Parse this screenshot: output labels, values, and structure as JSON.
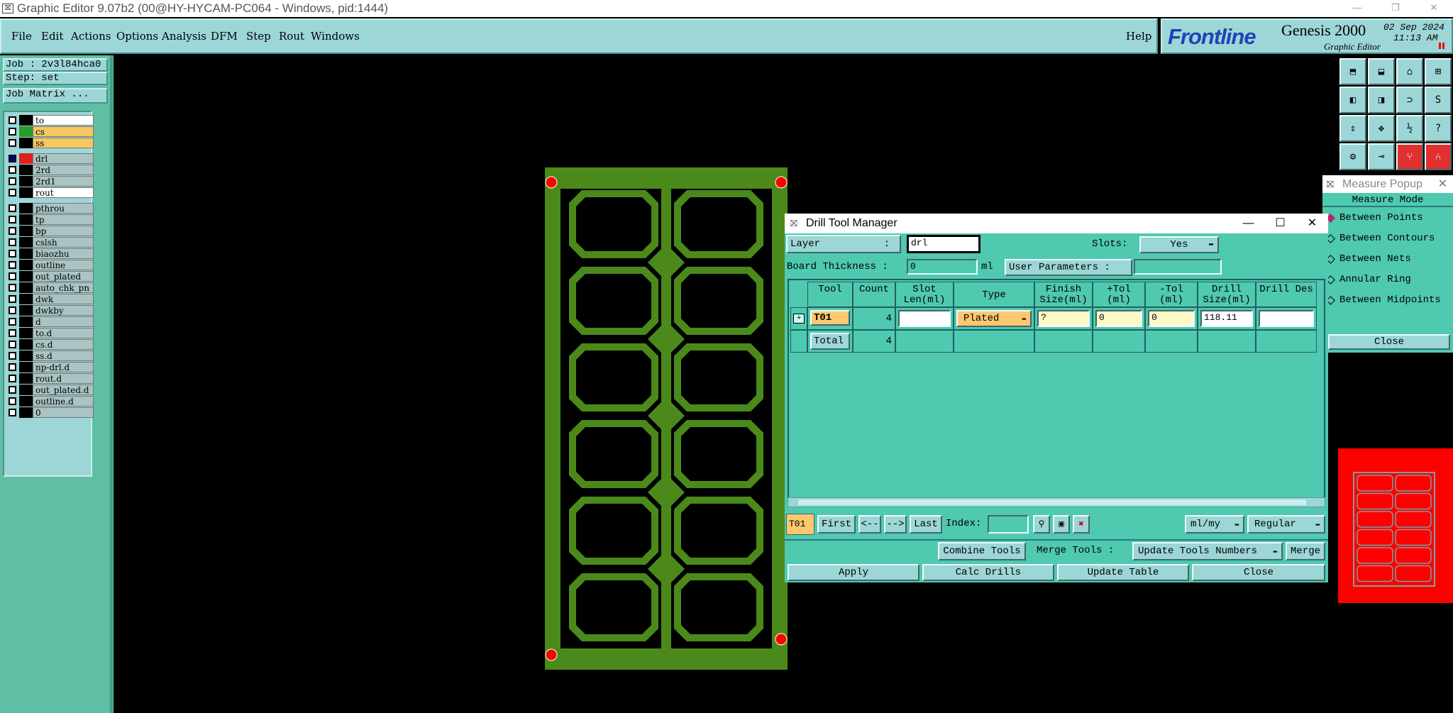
{
  "window": {
    "title": "Graphic Editor 9.07b2 (00@HY-HYCAM-PC064 - Windows, pid:1444)"
  },
  "menu": {
    "items": [
      "File",
      "Edit",
      "Actions",
      "Options",
      "Analysis",
      "DFM",
      "Step",
      "Rout",
      "Windows"
    ],
    "help": "Help"
  },
  "brand": {
    "logo": "Frontline",
    "product": "Genesis 2000",
    "subtitle": "Graphic Editor",
    "date": "02 Sep 2024",
    "time": "11:13 AM"
  },
  "left_panel": {
    "job": "Job : 2v3l84hca0",
    "step": "Step: set",
    "job_matrix": "Job Matrix ...",
    "layers": [
      {
        "name": "to",
        "swatch": "#000000",
        "bg": "#ffffff"
      },
      {
        "name": "cs",
        "swatch": "#2a9a2a",
        "bg": "#f5c860"
      },
      {
        "name": "ss",
        "swatch": "#000000",
        "bg": "#f5c860"
      },
      {
        "name": "drl",
        "swatch": "#e02020",
        "bg": "#aac4c4",
        "checked": true
      },
      {
        "name": "2rd",
        "swatch": "#000000",
        "bg": "#aac4c4"
      },
      {
        "name": "2rd1",
        "swatch": "#000000",
        "bg": "#aac4c4"
      },
      {
        "name": "rout",
        "swatch": "#000000",
        "bg": "#ffffff"
      },
      {
        "name": "pthrou",
        "swatch": "#000000",
        "bg": "#aac4c4"
      },
      {
        "name": "tp",
        "swatch": "#000000",
        "bg": "#aac4c4"
      },
      {
        "name": "bp",
        "swatch": "#000000",
        "bg": "#aac4c4"
      },
      {
        "name": "cslsh",
        "swatch": "#000000",
        "bg": "#aac4c4"
      },
      {
        "name": "biaozhu",
        "swatch": "#000000",
        "bg": "#aac4c4"
      },
      {
        "name": "outline",
        "swatch": "#000000",
        "bg": "#aac4c4"
      },
      {
        "name": "out_plated",
        "swatch": "#000000",
        "bg": "#aac4c4"
      },
      {
        "name": "auto_chk_pn",
        "swatch": "#000000",
        "bg": "#aac4c4"
      },
      {
        "name": "dwk",
        "swatch": "#000000",
        "bg": "#aac4c4"
      },
      {
        "name": "dwkby",
        "swatch": "#000000",
        "bg": "#aac4c4"
      },
      {
        "name": "d",
        "swatch": "#000000",
        "bg": "#aac4c4"
      },
      {
        "name": "to.d",
        "swatch": "#000000",
        "bg": "#aac4c4"
      },
      {
        "name": "cs.d",
        "swatch": "#000000",
        "bg": "#aac4c4"
      },
      {
        "name": "ss.d",
        "swatch": "#000000",
        "bg": "#aac4c4"
      },
      {
        "name": "np-drl.d",
        "swatch": "#000000",
        "bg": "#aac4c4"
      },
      {
        "name": "rout.d",
        "swatch": "#000000",
        "bg": "#aac4c4"
      },
      {
        "name": "out_plated.d",
        "swatch": "#000000",
        "bg": "#aac4c4"
      },
      {
        "name": "outline.d",
        "swatch": "#000000",
        "bg": "#aac4c4"
      },
      {
        "name": "0",
        "swatch": "#000000",
        "bg": "#aac4c4"
      }
    ]
  },
  "measure_popup": {
    "title": "Measure Popup",
    "mode_label": "Measure Mode",
    "options": [
      "Between Points",
      "Between Contours",
      "Between Nets",
      "Annular Ring",
      "Between Midpoints"
    ],
    "close": "Close"
  },
  "drill_tool_manager": {
    "title": "Drill Tool Manager",
    "layer_label": "Layer",
    "layer_colon": ":",
    "layer_value": "drl",
    "slots_label": "Slots:",
    "slots_value": "Yes",
    "board_thickness_label": "Board Thickness :",
    "board_thickness_value": "0",
    "board_thickness_unit": "ml",
    "user_params_label": "User Parameters :",
    "columns": [
      "Tool",
      "Count",
      "Slot Len(ml)",
      "Type",
      "Finish Size(ml)",
      "+Tol (ml)",
      "-Tol (ml)",
      "Drill Size(ml)",
      "Drill Des"
    ],
    "rows": [
      {
        "tool": "T01",
        "count": "4",
        "slot_len": "",
        "type": "Plated",
        "finish": "?",
        "ptol": "0",
        "ntol": "0",
        "drill": "118.11",
        "des": ""
      }
    ],
    "total_label": "Total",
    "total_count": "4",
    "nav": {
      "current": "T01",
      "first": "First",
      "prev": "<--",
      "next": "-->",
      "last": "Last",
      "index_label": "Index:",
      "units": "ml/my",
      "mode": "Regular"
    },
    "combine_tools": "Combine Tools",
    "merge_tools_label": "Merge Tools :",
    "merge_option": "Update Tools Numbers",
    "merge": "Merge",
    "buttons": [
      "Apply",
      "Calc Drills",
      "Update Table",
      "Close"
    ]
  }
}
